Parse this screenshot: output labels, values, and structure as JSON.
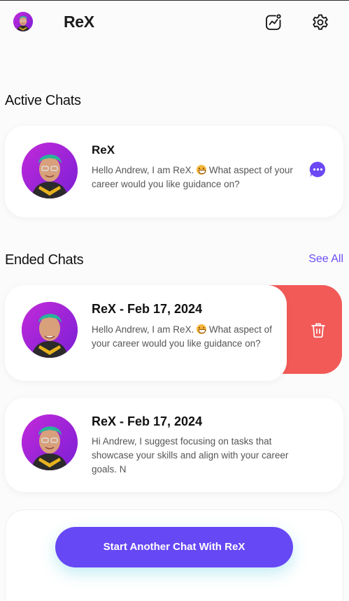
{
  "header": {
    "title": "ReX",
    "avatar_icon": "user-avatar",
    "insights_icon": "chart-trend-icon",
    "settings_icon": "gear-icon"
  },
  "active_chats": {
    "title": "Active Chats",
    "items": [
      {
        "name": "ReX",
        "message_before_emoji": "Hello Andrew, I am ReX. ",
        "message_after_emoji": " What aspect of your career would you like guidance on?",
        "action_icon": "chat-bubble-icon"
      }
    ]
  },
  "ended_chats": {
    "title": "Ended Chats",
    "see_all": "See All",
    "items": [
      {
        "name": "ReX - Feb 17, 2024",
        "message_before_emoji": "Hello Andrew, I am ReX. ",
        "message_after_emoji": " What aspect of your career would you like guidance on?",
        "swipe_action_icon": "trash-icon"
      },
      {
        "name": "ReX - Feb 17, 2024",
        "message": "Hi Andrew, I suggest focusing on tasks that showcase your skills and align with your career goals. N"
      }
    ]
  },
  "footer": {
    "start_button": "Start Another Chat With ReX"
  },
  "colors": {
    "accent": "#6748f5",
    "delete": "#f25a58",
    "link": "#6b4cf6"
  }
}
